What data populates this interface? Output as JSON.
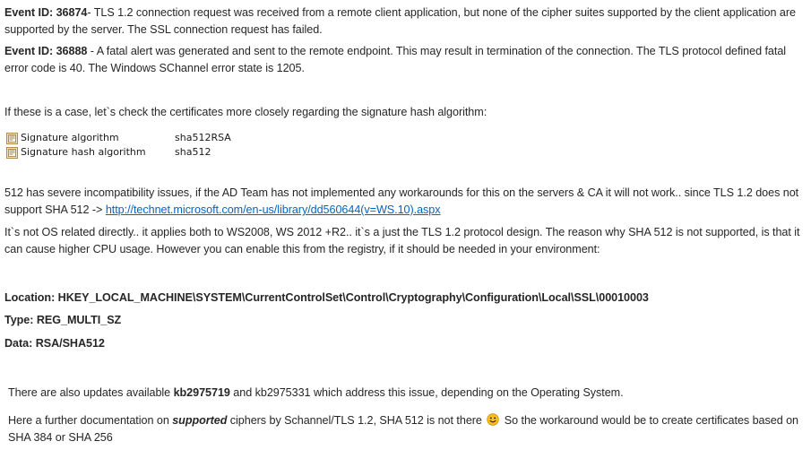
{
  "document": {
    "background_color": "#ffffff",
    "text_color": "#262626",
    "link_color": "#0563c1"
  },
  "events": [
    {
      "id_label": "Event ID: 36874",
      "description": "- TLS 1.2 connection request was received from a remote client application, but none of the cipher suites supported by the client application are supported by the server. The SSL connection request has failed."
    },
    {
      "id_label": "Event ID: 36888",
      "description": " - A fatal alert was generated and sent to the remote endpoint. This may result in termination of the connection. The TLS protocol defined fatal error code is 40. The Windows SChannel error state is 1205."
    }
  ],
  "intro_text": "If these is a case, let`s check the certificates more closely regarding the signature hash algorithm:",
  "certificate_details": {
    "icon_name": "certificate-field-icon",
    "rows": [
      {
        "field": "Signature algorithm",
        "value": "sha512RSA"
      },
      {
        "field": "Signature hash algorithm",
        "value": "sha512"
      }
    ]
  },
  "sha_paragraph": {
    "before_link": "512 has severe incompatibility issues, if the AD Team has not implemented any workarounds for this on the servers & CA it will not work.. since TLS 1.2 does not support SHA 512 -> ",
    "link_text": "http://technet.microsoft.com/en-us/library/dd560644(v=WS.10).aspx",
    "link_href": "http://technet.microsoft.com/en-us/library/dd560644(v=WS.10).aspx",
    "after_link": ""
  },
  "os_paragraph": "It`s not OS related directly.. it applies both to WS2008, WS 2012 +R2.. it`s a just the TLS 1.2 protocol design. The reason why SHA 512 is not supported, is that it can cause higher CPU usage. However you can enable this from the registry, if it should be needed in your environment:",
  "registry": {
    "location_label": "Location:",
    "location_value": " HKEY_LOCAL_MACHINE\\SYSTEM\\CurrentControlSet\\Control\\Cryptography\\Configuration\\Local\\SSL\\00010003",
    "type_label": "Type:",
    "type_value": " REG_MULTI_SZ",
    "data_label": "Data:",
    "data_value": " RSA/SHA512"
  },
  "updates_paragraph": {
    "prefix": "There are also updates available ",
    "kb_bold": "kb2975719",
    "middle": " and kb2975331 which address this issue, depending on the Operating System.",
    "suffix": ""
  },
  "documentation_paragraph": {
    "part1": "Here a further documentation on ",
    "emphasis": "supported",
    "part2": " ciphers by Schannel/TLS 1.2, SHA 512 is not there ",
    "emoji_name": "smiley-face-emoji",
    "part3": " So the workaround would be to create certificates based on SHA 384 or SHA 256"
  }
}
